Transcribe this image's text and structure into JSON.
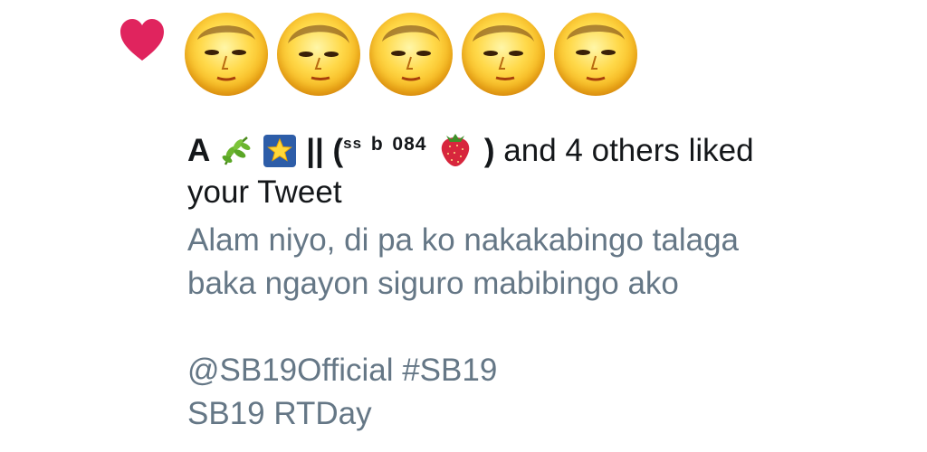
{
  "notification": {
    "type_icon": "heart-icon",
    "heart_color": "#e0245e",
    "avatar_count": 5,
    "liker": {
      "name_prefix": "A",
      "emoji_1": "herb-emoji",
      "emoji_2": "glowing-star-emoji",
      "separator": "||",
      "paren_open": "(",
      "handle_small": "ss",
      "handle_b": "b",
      "handle_num": "084",
      "emoji_3": "strawberry-emoji",
      "paren_close": ")",
      "suffix": "and 4 others liked",
      "line2": "your Tweet"
    },
    "tweet": {
      "line1": "Alam niyo, di pa ko nakakabingo talaga",
      "line2": "baka ngayon siguro mabibingo ako",
      "line3": "@SB19Official #SB19",
      "line4": "SB19 RTDay"
    },
    "text_color": "#14171a",
    "secondary_color": "#657786"
  }
}
